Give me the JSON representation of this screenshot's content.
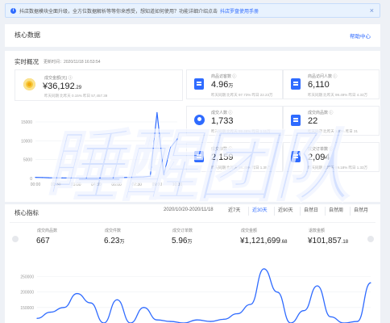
{
  "notice": {
    "text": "抖店数据模块全面升级，全方位数据解析等等你来感受，想知道如何使用？功能详细介绍点击",
    "link": "抖店罗盘使用手册"
  },
  "core_header": {
    "title": "核心数据",
    "help": "帮助中心"
  },
  "realtime": {
    "title": "实时概况",
    "updated": "更新时间：2020/11/18 16:53:54",
    "gmv": {
      "label": "成交金额(元) ⓘ",
      "value": "¥36,192",
      "decimals": ".29",
      "compare": "昨天同期   比昨天 0.15%   昨日 57,457.39"
    },
    "stats": [
      {
        "label": "商品访客数 ⓘ",
        "value": "4.96",
        "unit": "万",
        "compare": "昨天同期 比昨天 97.73%   昨日 22.23万",
        "icon": "doc-icon"
      },
      {
        "label": "商品访问人数 ⓘ",
        "value": "6,110",
        "unit": "",
        "compare": "昨天同期 比昨天 99.49%   昨日 4.33万",
        "icon": "doc-icon"
      },
      {
        "label": "成交人数 ⓘ",
        "value": "1,733",
        "unit": "",
        "compare": "昨天同期 比昨天 99.46%   昨日 1.11万",
        "icon": "user-icon"
      },
      {
        "label": "成交商品数 ⓘ",
        "value": "22",
        "unit": "",
        "compare": "昨天同期 比昨天 100%   昨日 31",
        "icon": "doc-icon"
      },
      {
        "label": "成交单数 ⓘ",
        "value": "2,159",
        "unit": "",
        "compare": "昨天同期 比昨天 99.35%   昨日 1.35万",
        "icon": "doc-icon"
      },
      {
        "label": "成交订单数 ⓘ",
        "value": "2,094",
        "unit": "",
        "compare": "昨天同期 比昨天 99.18%   昨日 1.33万",
        "icon": "doc-icon"
      }
    ],
    "chart_data": {
      "type": "line",
      "x": [
        "00:00",
        "00:30",
        "01:00",
        "01:30",
        "02:00",
        "02:30",
        "03:00",
        "03:30",
        "04:00",
        "04:30",
        "05:00",
        "05:30",
        "06:00",
        "06:30",
        "07:00",
        "07:30",
        "08:00",
        "08:30",
        "09:00",
        "09:30",
        "10:00",
        "10:30"
      ],
      "xticks": [
        "00:00",
        "01:30",
        "03:00",
        "04:30",
        "06:00",
        "07:30",
        "09:00",
        "10:30"
      ],
      "yticks": [
        "15000",
        "10000",
        "5000",
        "0"
      ],
      "ylim": [
        0,
        18000
      ],
      "series": [
        {
          "values": [
            300,
            250,
            200,
            180,
            150,
            120,
            100,
            100,
            100,
            100,
            120,
            150,
            200,
            250,
            300,
            350,
            400,
            600,
            17500,
            1000,
            8200,
            10500
          ]
        }
      ],
      "color": "#2f6bff"
    }
  },
  "core_metrics": {
    "title": "核心指标",
    "range": "2020/10/20-2020/11/18",
    "tabs": [
      "近7天",
      "近30天",
      "近90天",
      "自然日",
      "自然周",
      "自然月"
    ],
    "active_tab": 1,
    "items": [
      {
        "label": "成交商品数",
        "value": "667",
        "unit": "",
        "decimals": ""
      },
      {
        "label": "成交件数",
        "value": "6.23",
        "unit": "万",
        "decimals": ""
      },
      {
        "label": "成交订单数",
        "value": "5.96",
        "unit": "万",
        "decimals": ""
      },
      {
        "label": "成交金额",
        "value": "¥1,121,699",
        "unit": "",
        "decimals": ".68"
      },
      {
        "label": "退款金额",
        "value": "¥101,857",
        "unit": "",
        "decimals": ".18"
      }
    ],
    "chart_data": {
      "type": "line",
      "yticks": [
        "250000",
        "200000",
        "150000"
      ],
      "ylim": [
        100000,
        280000
      ],
      "series": [
        {
          "values": [
            115000,
            135000,
            150000,
            195000,
            165000,
            100000,
            175000,
            100000,
            150000,
            110000,
            105000,
            100000,
            110000,
            105000,
            112000,
            130000,
            160000,
            275000,
            200000,
            100000,
            140000,
            220000,
            120000,
            100000,
            105000,
            230000
          ]
        }
      ],
      "color": "#2f6bff"
    }
  },
  "watermark": {
    "text": "睡醒团队"
  }
}
